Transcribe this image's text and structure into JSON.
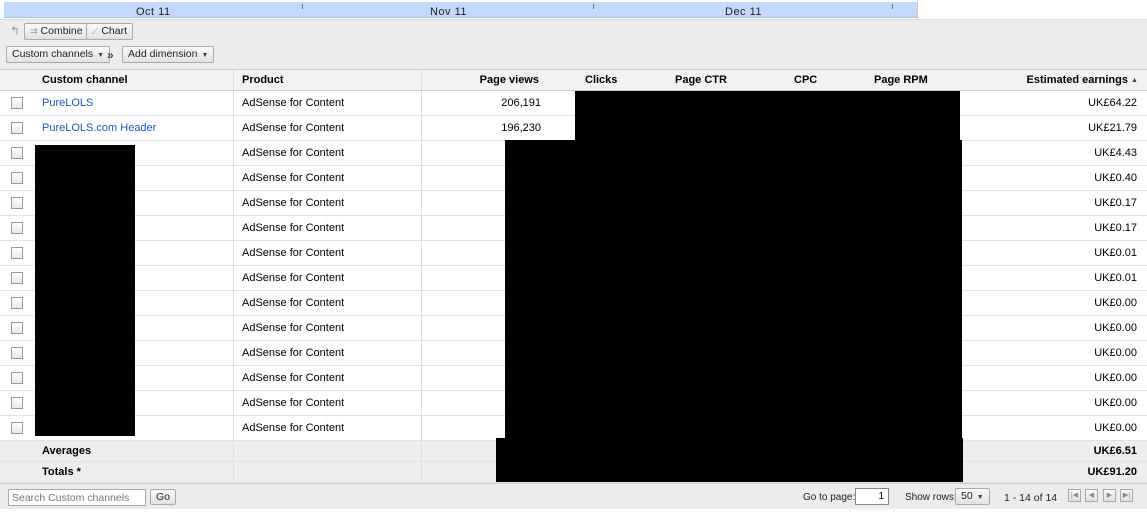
{
  "timeline": {
    "labels": [
      "Oct 11",
      "Nov 11",
      "Dec 11"
    ]
  },
  "toolbar": {
    "combine_label": "Combine",
    "chart_label": "Chart",
    "custom_channels_label": "Custom channels",
    "add_dimension_label": "Add dimension"
  },
  "table": {
    "headers": {
      "channel": "Custom channel",
      "product": "Product",
      "page_views": "Page views",
      "clicks": "Clicks",
      "page_ctr": "Page CTR",
      "cpc": "CPC",
      "page_rpm": "Page RPM",
      "earnings": "Estimated earnings",
      "sort_indicator": "▲"
    },
    "rows": [
      {
        "channel": "PureLOLS",
        "product": "AdSense for Content",
        "page_views": "206,191",
        "earnings": "UK£64.22"
      },
      {
        "channel": "PureLOLS.com Header",
        "product": "AdSense for Content",
        "page_views": "196,230",
        "earnings": "UK£21.79"
      },
      {
        "channel": "",
        "product": "AdSense for Content",
        "page_views": "",
        "earnings": "UK£4.43"
      },
      {
        "channel": "",
        "product": "AdSense for Content",
        "page_views": "",
        "earnings": "UK£0.40"
      },
      {
        "channel": "",
        "product": "AdSense for Content",
        "page_views": "",
        "earnings": "UK£0.17"
      },
      {
        "channel": "",
        "product": "AdSense for Content",
        "page_views": "",
        "earnings": "UK£0.17"
      },
      {
        "channel": "",
        "product": "AdSense for Content",
        "page_views": "",
        "earnings": "UK£0.01"
      },
      {
        "channel": "",
        "product": "AdSense for Content",
        "page_views": "",
        "earnings": "UK£0.01"
      },
      {
        "channel": "",
        "product": "AdSense for Content",
        "page_views": "",
        "earnings": "UK£0.00"
      },
      {
        "channel": "",
        "product": "AdSense for Content",
        "page_views": "",
        "earnings": "UK£0.00"
      },
      {
        "channel": "",
        "product": "AdSense for Content",
        "page_views": "",
        "earnings": "UK£0.00"
      },
      {
        "channel": "",
        "product": "AdSense for Content",
        "page_views": "",
        "earnings": "UK£0.00"
      },
      {
        "channel": "",
        "product": "AdSense for Content",
        "page_views": "",
        "earnings": "UK£0.00"
      },
      {
        "channel": "",
        "product": "AdSense for Content",
        "page_views": "",
        "earnings": "UK£0.00"
      }
    ],
    "averages": {
      "label": "Averages",
      "earnings": "UK£6.51"
    },
    "totals": {
      "label": "Totals *",
      "earnings": "UK£91.20"
    }
  },
  "footer": {
    "search_placeholder": "Search Custom channels",
    "go_label": "Go",
    "go_to_page_label": "Go to page:",
    "page_value": "1",
    "show_rows_label": "Show rows:",
    "rows_value": "50",
    "range_text": "1 - 14 of 14"
  }
}
